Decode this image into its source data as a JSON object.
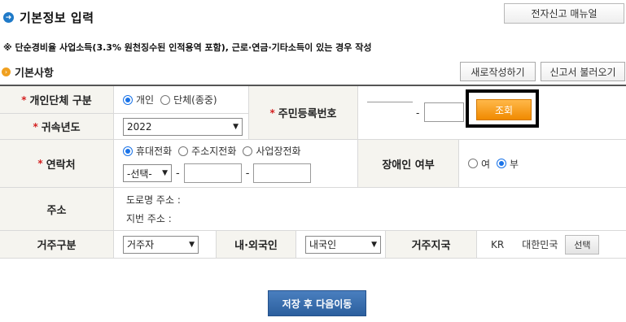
{
  "header": {
    "title": "기본정보 입력",
    "manual_button": "전자신고 매뉴얼",
    "notice": "※ 단순경비율 사업소득(3.3% 원천징수된 인적용역 포함), 근로·연금·기타소득이 있는 경우 작성"
  },
  "section": {
    "title": "기본사항",
    "new_button": "새로작성하기",
    "load_button": "신고서 불러오기"
  },
  "form": {
    "person_type": {
      "label": "개인단체 구분",
      "options": [
        "개인",
        "단체(종중)"
      ],
      "selected": "개인"
    },
    "year": {
      "label": "귀속년도",
      "value": "2022"
    },
    "resident_no": {
      "label": "주민등록번호",
      "separator": "-",
      "search_button": "조회"
    },
    "contact": {
      "label": "연락처",
      "options": [
        "휴대전화",
        "주소지전화",
        "사업장전화"
      ],
      "selected": "휴대전화",
      "prefix_select": "-선택-",
      "separator": "-"
    },
    "disability": {
      "label": "장애인 여부",
      "options": [
        "여",
        "부"
      ],
      "selected": "부"
    },
    "address": {
      "label": "주소",
      "road_label": "도로명 주소 :",
      "lot_label": "지번 주소 :"
    },
    "residence": {
      "label": "거주구분",
      "value": "거주자"
    },
    "nationality": {
      "label": "내·외국인",
      "value": "내국인"
    },
    "country": {
      "label": "거주지국",
      "code": "KR",
      "name": "대한민국",
      "choose_button": "선택"
    }
  },
  "footer": {
    "save_button": "저장 후 다음이동"
  },
  "colors": {
    "accent": "#1f7ac8",
    "search_button": "#f08a00",
    "save_button": "#2c5f9e",
    "required": "#d42020"
  }
}
